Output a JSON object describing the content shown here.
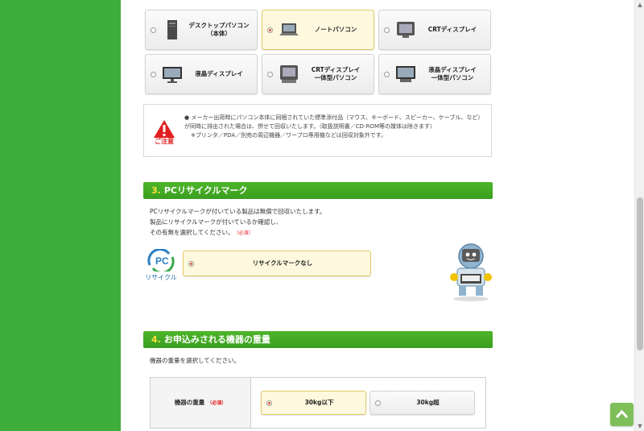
{
  "device_types": [
    {
      "label": "デスクトップパソコン\n（本体）",
      "icon": "desktop-pc-icon",
      "selected": false
    },
    {
      "label": "ノートパソコン",
      "icon": "laptop-icon",
      "selected": true
    },
    {
      "label": "CRTディスプレイ",
      "icon": "crt-display-icon",
      "selected": false
    },
    {
      "label": "液晶ディスプレイ",
      "icon": "lcd-display-icon",
      "selected": false
    },
    {
      "label": "CRTディスプレイ\n一体型パソコン",
      "icon": "crt-all-in-one-icon",
      "selected": false
    },
    {
      "label": "液晶ディスプレイ\n一体型パソコン",
      "icon": "lcd-all-in-one-icon",
      "selected": false
    }
  ],
  "caution": {
    "label": "ご注意",
    "text": "● メーカー出荷時にパソコン本体に同梱されていた標準添付品（マウス、キーボード、スピーカー、ケーブル、など）が同時に排出された場合は、併せて回収いたします。（取扱説明書／CD-ROM等の媒体は除きます）",
    "note": "※プリンタ／PDA／別売の周辺機器／ワープロ専用機などは回収対象外です。"
  },
  "section3": {
    "number": "3.",
    "title": "PCリサイクルマーク",
    "line1": "PCリサイクルマークが付いている製品は無償で回収いたします。",
    "line2": "製品にリサイクルマークが付いているか確認し、",
    "line3": "その有無を選択してください。",
    "required": "（必須）",
    "logo_text": "PC",
    "logo_caption": "リサイクル",
    "option_label": "リサイクルマークなし"
  },
  "section4": {
    "number": "4.",
    "title": "お申込みされる機器の重量",
    "instruction": "機器の重量を選択してください。",
    "row_label": "機器の重量",
    "required": "（必須）",
    "options": [
      {
        "label": "30kg以下",
        "selected": true
      },
      {
        "label": "30kg超",
        "selected": false
      }
    ]
  },
  "colors": {
    "page_bg": "#3eae3a",
    "section_header": "#3a9e1f",
    "section_number": "#ffe23b",
    "required": "#e02020",
    "selected_bg": "#fdf8de"
  },
  "icons": {
    "page_top": "chevron-up-icon",
    "caution": "warning-triangle-icon"
  }
}
